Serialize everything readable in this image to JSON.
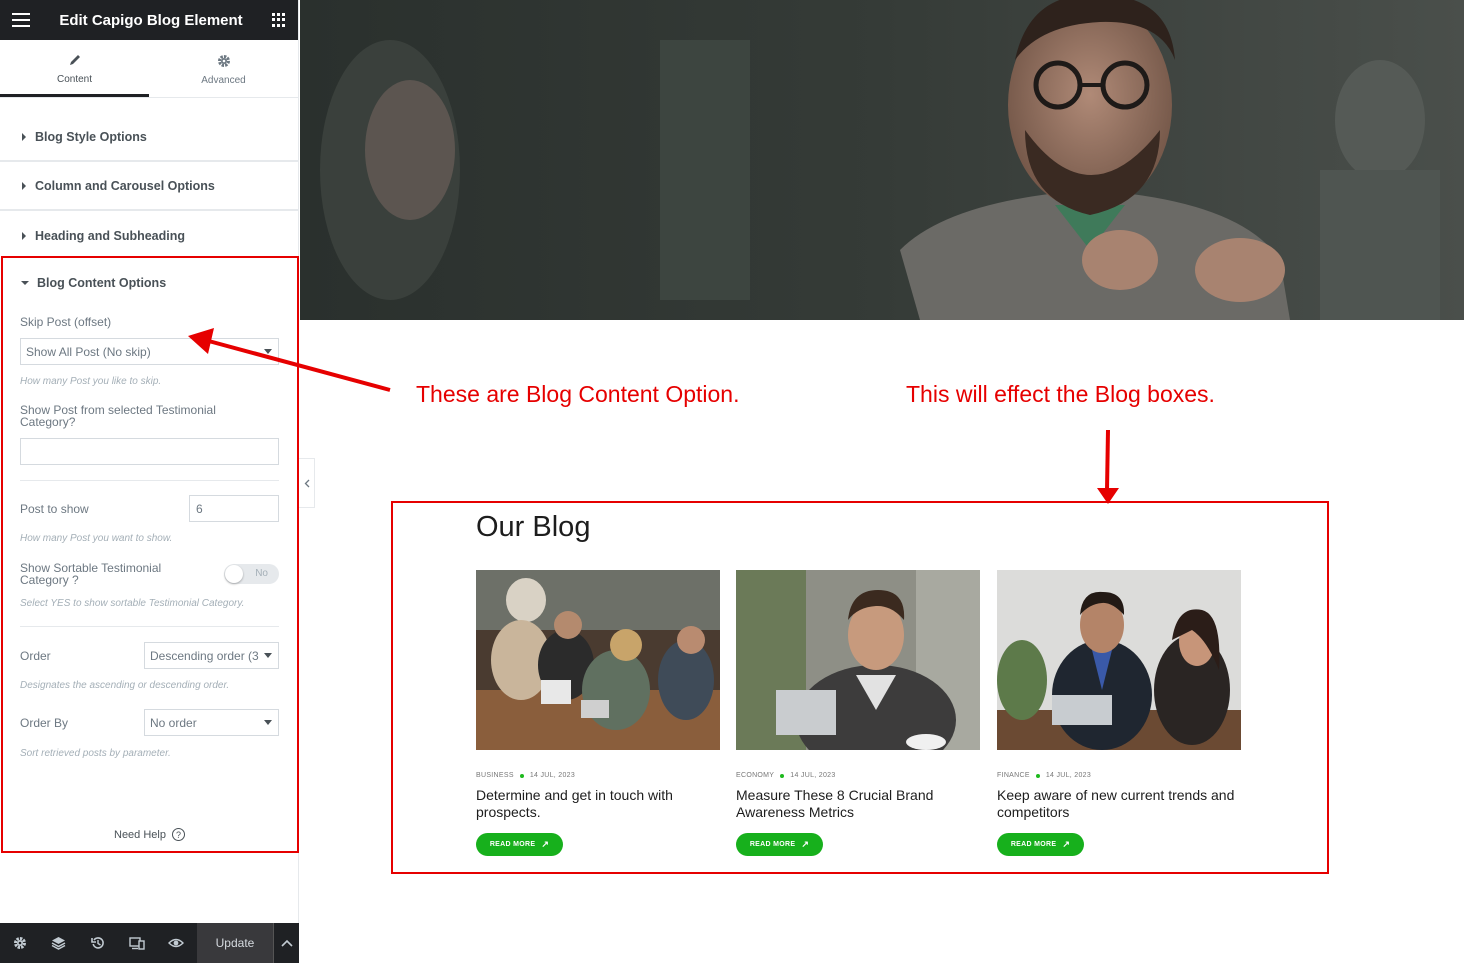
{
  "editor": {
    "title": "Edit Capigo Blog Element",
    "tabs": [
      {
        "label": "Content",
        "icon": "pencil-icon"
      },
      {
        "label": "Advanced",
        "icon": "gear-icon"
      }
    ],
    "sections": [
      {
        "label": "Blog Style Options"
      },
      {
        "label": "Column and Carousel Options"
      },
      {
        "label": "Heading and Subheading"
      },
      {
        "label": "Blog Content Options"
      }
    ],
    "fields": {
      "skip_post": {
        "label": "Skip Post (offset)",
        "value": "Show All Post (No skip)",
        "description": "How many Post you like to skip."
      },
      "category": {
        "label": "Show Post from selected Testimonial Category?",
        "value": ""
      },
      "post_to_show": {
        "label": "Post to show",
        "value": "6",
        "description": "How many Post you want to show."
      },
      "sortable": {
        "label": "Show Sortable Testimonial Category ?",
        "value": "No",
        "description": "Select YES to show sortable Testimonial Category."
      },
      "order": {
        "label": "Order",
        "value": "Descending order (3",
        "description": "Designates the ascending or descending order."
      },
      "order_by": {
        "label": "Order By",
        "value": "No order",
        "description": "Sort retrieved posts by parameter."
      }
    },
    "need_help": "Need Help",
    "update_label": "Update",
    "bottom_icons": [
      "settings-icon",
      "layers-icon",
      "history-icon",
      "responsive-icon",
      "eye-icon"
    ]
  },
  "annotations": {
    "left": "These are Blog Content Option.",
    "right": "This will effect the Blog boxes."
  },
  "blog": {
    "heading": "Our Blog",
    "read_more": "READ MORE",
    "posts": [
      {
        "category": "BUSINESS",
        "date": "14 JUL, 2023",
        "title": "Determine and get in touch with prospects."
      },
      {
        "category": "ECONOMY",
        "date": "14 JUL, 2023",
        "title": "Measure These 8 Crucial Brand Awareness Metrics"
      },
      {
        "category": "FINANCE",
        "date": "14 JUL, 2023",
        "title": "Keep aware of new current trends and competitors"
      }
    ]
  },
  "colors": {
    "annotation_red": "#e60000",
    "accent_green": "#17b01c",
    "panel_dark": "#1f2124"
  }
}
